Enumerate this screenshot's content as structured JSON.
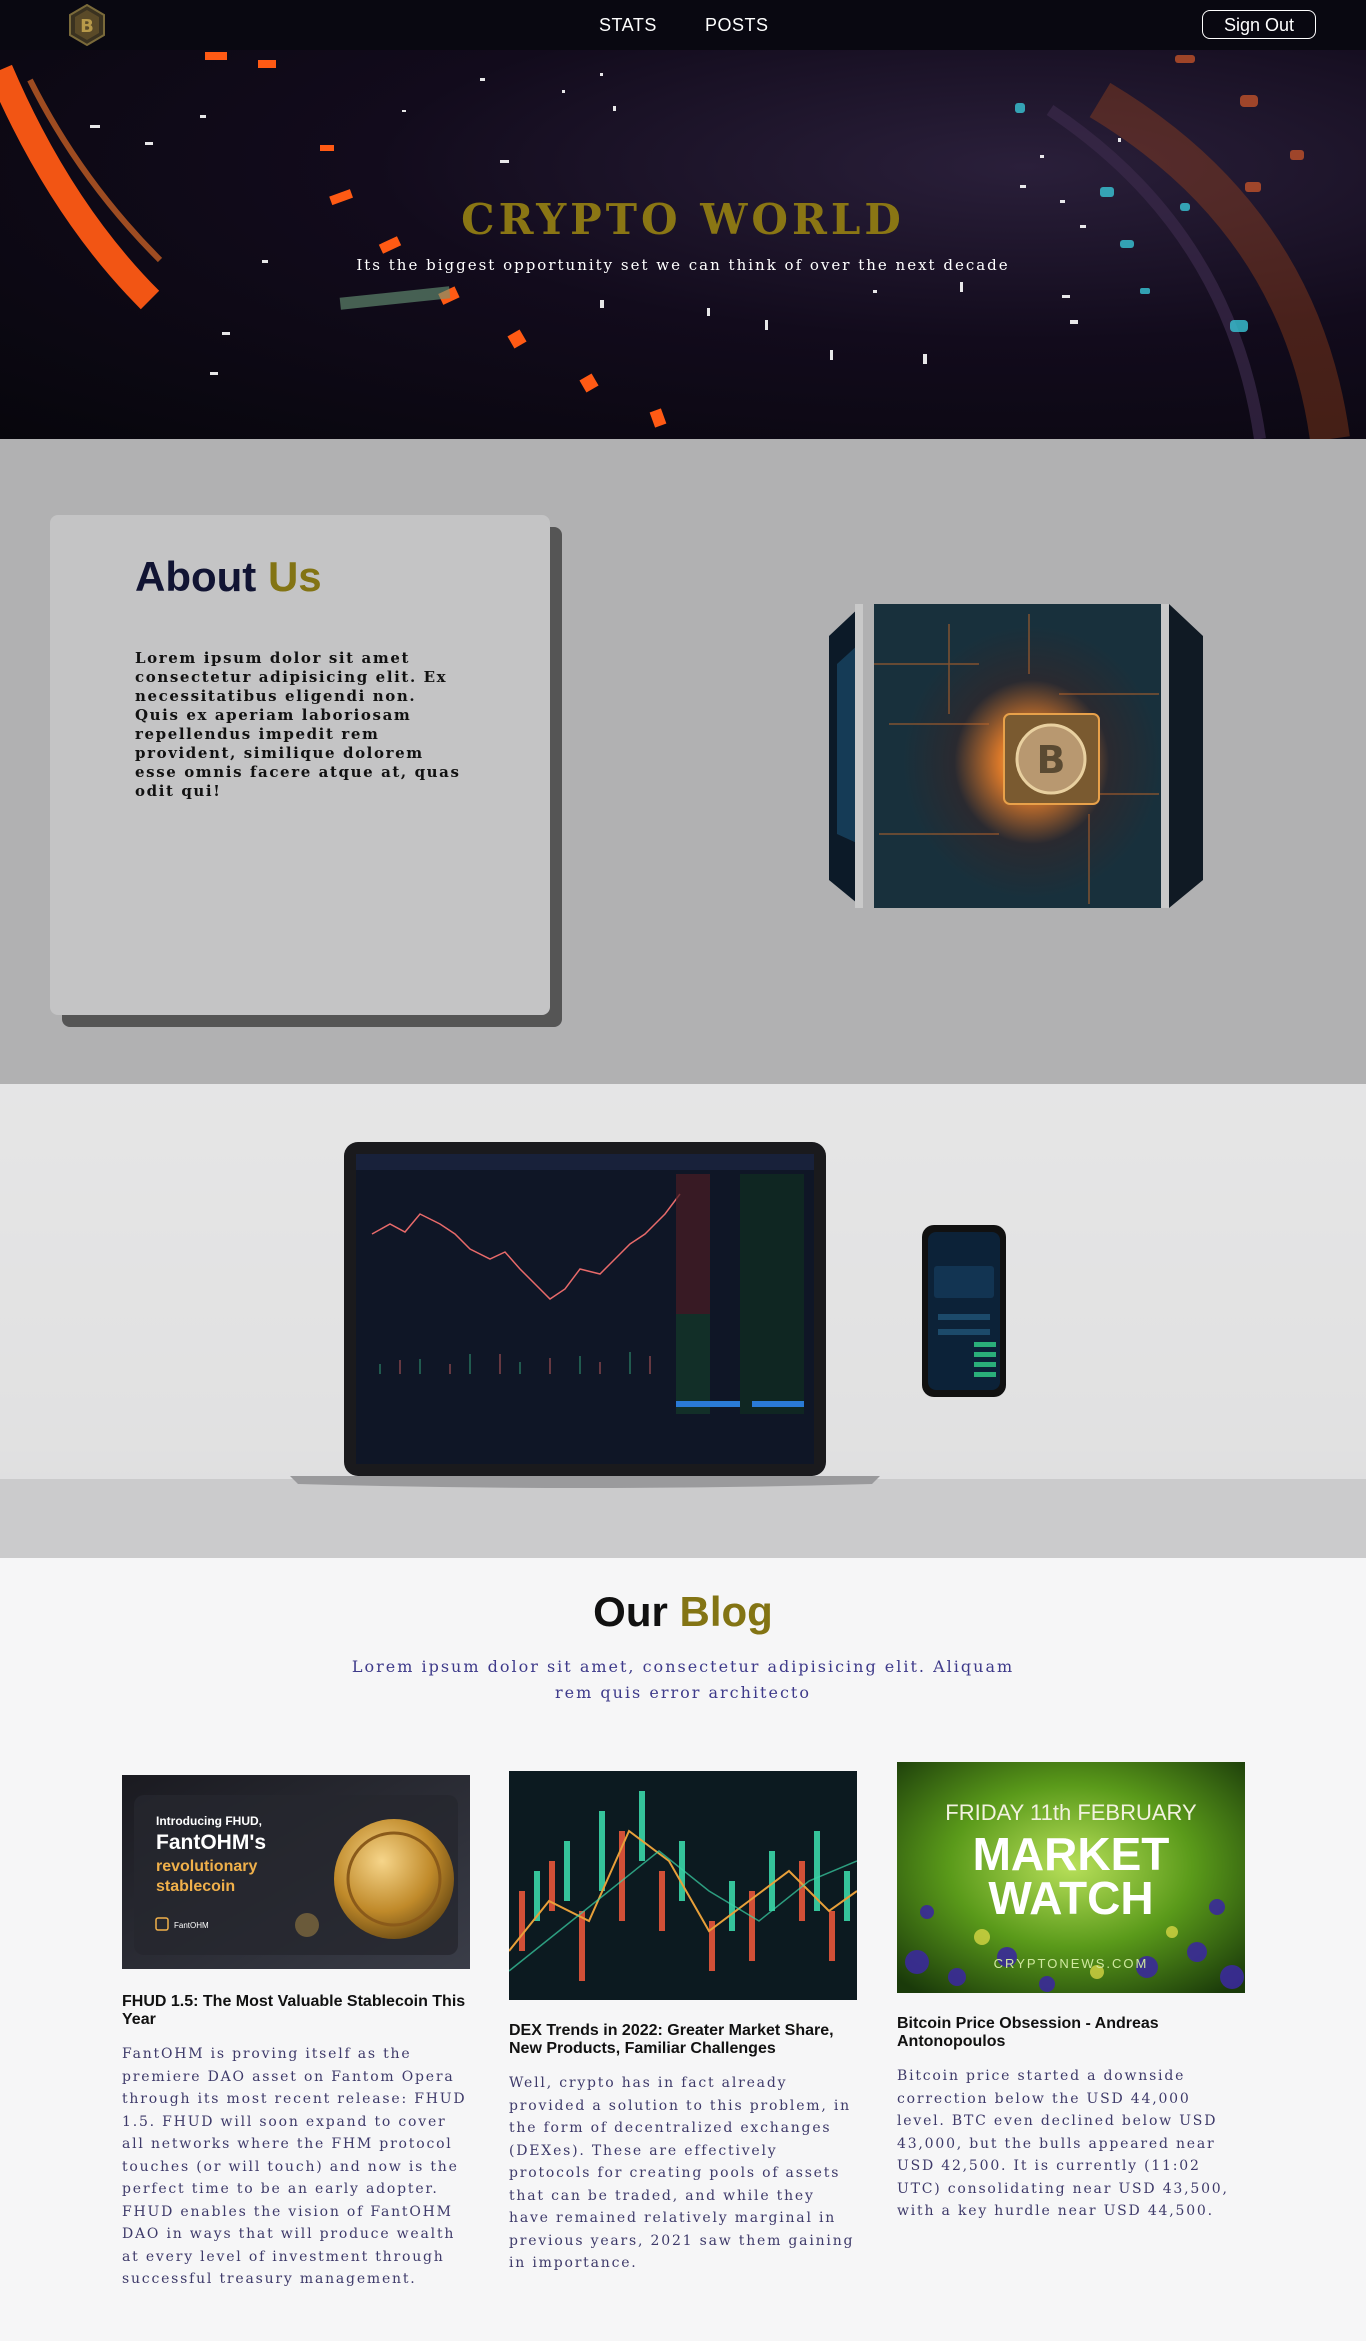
{
  "nav": {
    "links": [
      "STATS",
      "POSTS"
    ],
    "signout_label": "Sign Out",
    "logo_icon": "bitcoin-logo-icon"
  },
  "hero": {
    "title": "CRYPTO WORLD",
    "subtitle": "Its the biggest opportunity set we can think of over the next decade"
  },
  "about": {
    "title_part1": "About",
    "title_part2": "Us",
    "text": "Lorem ipsum dolor sit amet consectetur adipisicing elit. Ex necessitatibus eligendi non. Quis ex aperiam laboriosam repellendus impedit rem provident, similique dolorem esse omnis facere atque at, quas odit qui!"
  },
  "blog": {
    "title_part1": "Our",
    "title_part2": "Blog",
    "subtitle": "Lorem ipsum dolor sit amet, consectetur adipisicing elit. Aliquam rem quis error architecto",
    "posts": [
      {
        "image_lines": [
          "Introducing FHUD,",
          "FantOHM's",
          "revolutionary",
          "stablecoin",
          "FantOHM"
        ],
        "title": "FHUD 1.5: The Most Valuable Stablecoin This Year",
        "text": "FantOHM is proving itself as the premiere DAO asset on Fantom Opera through its most recent release: FHUD 1.5. FHUD will soon expand to cover all networks where the FHM protocol touches (or will touch) and now is the perfect time to be an early adopter. FHUD enables the vision of FantOHM DAO in ways that will produce wealth at every level of investment through successful treasury management."
      },
      {
        "title": "DEX Trends in 2022: Greater Market Share, New Products, Familiar Challenges",
        "text": "Well, crypto has in fact already provided a solution to this problem, in the form of decentralized exchanges (DEXes). These are effectively protocols for creating pools of assets that can be traded, and while they have remained relatively marginal in previous years, 2021 saw them gaining in importance."
      },
      {
        "image_lines": [
          "FRIDAY 11th FEBRUARY",
          "MARKET",
          "WATCH",
          "CRYPTONEWS.COM"
        ],
        "title": "Bitcoin Price Obsession - Andreas Antonopoulos",
        "text": "Bitcoin price started a downside correction below the USD 44,000 level. BTC even declined below USD 43,000, but the bulls appeared near USD 42,500. It is currently (11:02 UTC) consolidating near USD 43,500, with a key hurdle near USD 44,500."
      }
    ]
  },
  "colors": {
    "accent_gold": "#837414",
    "nav_bg": "#090811",
    "about_bg": "#b1b1b2",
    "blog_text": "#3e3a8a"
  }
}
